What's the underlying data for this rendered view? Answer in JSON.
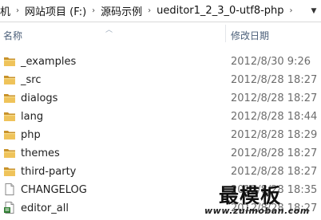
{
  "breadcrumb": {
    "items": [
      {
        "label": "机"
      },
      {
        "label": "网站项目 (F:)"
      },
      {
        "label": "源码示例"
      },
      {
        "label": "ueditor1_2_3_0-utf8-php"
      }
    ],
    "separator": "›"
  },
  "columns": {
    "name": "名称",
    "date": "修改日期",
    "sort_icon": "chevron-up-icon"
  },
  "files": [
    {
      "name": "_examples",
      "date": "2012/8/30 9:26",
      "type": "folder"
    },
    {
      "name": "_src",
      "date": "2012/8/28 18:27",
      "type": "folder"
    },
    {
      "name": "dialogs",
      "date": "2012/8/28 18:27",
      "type": "folder"
    },
    {
      "name": "lang",
      "date": "2012/8/28 18:44",
      "type": "folder"
    },
    {
      "name": "php",
      "date": "2012/8/28 18:29",
      "type": "folder"
    },
    {
      "name": "themes",
      "date": "2012/8/28 18:27",
      "type": "folder"
    },
    {
      "name": "third-party",
      "date": "2012/8/28 18:27",
      "type": "folder"
    },
    {
      "name": "CHANGELOG",
      "date": "2012/8/28 18:35",
      "type": "file"
    },
    {
      "name": "editor_all",
      "date": "2012/8/28 18:27",
      "type": "script"
    }
  ],
  "watermark": {
    "title": "最模板",
    "url": "www.zuimoban.com"
  },
  "colors": {
    "folder": "#e8b84a",
    "folder_dark": "#c8922a",
    "header_text": "#4c607a",
    "date_text": "#6d6d6d"
  }
}
